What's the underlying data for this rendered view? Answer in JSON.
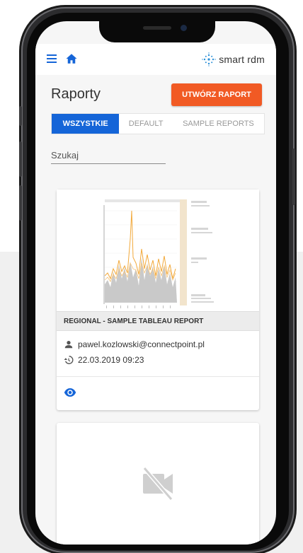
{
  "app": {
    "logo_text": "smart rdm",
    "brand_color": "#1565d8",
    "accent_color": "#f15a24"
  },
  "header": {
    "title": "Raporty",
    "create_button": "UTWÓRZ RAPORT"
  },
  "tabs": [
    {
      "label": "WSZYSTKIE",
      "active": true
    },
    {
      "label": "DEFAULT",
      "active": false
    },
    {
      "label": "SAMPLE REPORTS",
      "active": false
    }
  ],
  "search": {
    "placeholder": "Szukaj",
    "value": ""
  },
  "reports": [
    {
      "title": "REGIONAL - SAMPLE TABLEAU REPORT",
      "owner": "pawel.kozlowski@connectpoint.pl",
      "date": "22.03.2019 09:23",
      "thumbnail": "tableau-chart-preview"
    },
    {
      "title": "",
      "thumbnail": "no-video-icon"
    }
  ],
  "icons": {
    "menu": "menu-icon",
    "home": "home-icon",
    "user": "person-icon",
    "history": "history-icon",
    "view": "eye-icon",
    "no_preview": "videocam-off-icon"
  }
}
